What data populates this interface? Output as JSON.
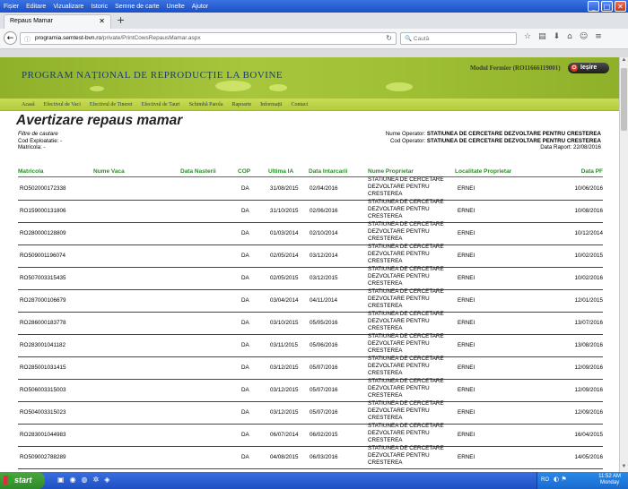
{
  "browser": {
    "menu": [
      "Fișier",
      "Editare",
      "Vizualizare",
      "Istoric",
      "Semne de carte",
      "Unelte",
      "Ajutor"
    ],
    "tab_title": "Repaus Mamar",
    "url_domain": "programia.semtest-bvn.ro",
    "url_prefix": "",
    "url_path": "/private/PrintCowsRepausMamar.aspx",
    "search_placeholder": "Caută"
  },
  "header": {
    "title": "PROGRAM NAȚIONAL DE REPRODUCȚIE LA BOVINE",
    "user_label": "Modul Fermier (RO11666119001)",
    "exit_label": "Ieșire"
  },
  "nav": [
    "Acasă",
    "Efectivul de Vaci",
    "Efectivul de Tineret",
    "Efectivul de Tauri",
    "Schimbă Parola",
    "Rapoarte",
    "Informații",
    "Contact"
  ],
  "report": {
    "title": "Avertizare repaus mamar",
    "filters_label": "Filtre de cautare",
    "cod_exploatatie": "Cod Exploatatie: -",
    "matricola_filter": "Matricola: -",
    "operator_name_label": "Nume Operator:",
    "operator_name": "STATIUNEA DE CERCETARE DEZVOLTARE PENTRU CRESTEREA",
    "operator_code_label": "Cod Operator:",
    "operator_code": "STATIUNEA DE CERCETARE DEZVOLTARE PENTRU CRESTEREA",
    "report_date": "Data Raport: 22/08/2016"
  },
  "columns": [
    "Matricola",
    "Nume Vaca",
    "Data Nasterii",
    "COP",
    "Ultima IA",
    "Data Intarcarii",
    "Nume Proprietar",
    "Localitate Proprietar",
    "Data PF"
  ],
  "rows": [
    {
      "matricola": "RO502000172338",
      "cop": "DA",
      "ultima_ia": "31/08/2015",
      "intarcare": "02/04/2016",
      "proprietar": "STATIUNEA DE CERCETARE DEZVOLTARE PENTRU CRESTEREA",
      "localitate": "ERNEI",
      "pf": "10/06/2016"
    },
    {
      "matricola": "RO159000131806",
      "cop": "DA",
      "ultima_ia": "31/10/2015",
      "intarcare": "02/06/2016",
      "proprietar": "STATIUNEA DE CERCETARE DEZVOLTARE PENTRU CRESTEREA",
      "localitate": "ERNEI",
      "pf": "10/08/2016"
    },
    {
      "matricola": "RO280000128809",
      "cop": "DA",
      "ultima_ia": "01/03/2014",
      "intarcare": "02/10/2014",
      "proprietar": "STATIUNEA DE CERCETARE DEZVOLTARE PENTRU CRESTEREA",
      "localitate": "ERNEI",
      "pf": "10/12/2014"
    },
    {
      "matricola": "RO509001196074",
      "cop": "DA",
      "ultima_ia": "02/05/2014",
      "intarcare": "03/12/2014",
      "proprietar": "STATIUNEA DE CERCETARE DEZVOLTARE PENTRU CRESTEREA",
      "localitate": "ERNEI",
      "pf": "10/02/2015"
    },
    {
      "matricola": "RO507003315435",
      "cop": "DA",
      "ultima_ia": "02/05/2015",
      "intarcare": "03/12/2015",
      "proprietar": "STATIUNEA DE CERCETARE DEZVOLTARE PENTRU CRESTEREA",
      "localitate": "ERNEI",
      "pf": "10/02/2016"
    },
    {
      "matricola": "RO287000106679",
      "cop": "DA",
      "ultima_ia": "03/04/2014",
      "intarcare": "04/11/2014",
      "proprietar": "STATIUNEA DE CERCETARE DEZVOLTARE PENTRU CRESTEREA",
      "localitate": "ERNEI",
      "pf": "12/01/2015"
    },
    {
      "matricola": "RO286000183778",
      "cop": "DA",
      "ultima_ia": "03/10/2015",
      "intarcare": "05/05/2016",
      "proprietar": "STATIUNEA DE CERCETARE DEZVOLTARE PENTRU CRESTEREA",
      "localitate": "ERNEI",
      "pf": "13/07/2016"
    },
    {
      "matricola": "RO283001041182",
      "cop": "DA",
      "ultima_ia": "03/11/2015",
      "intarcare": "05/06/2016",
      "proprietar": "STATIUNEA DE CERCETARE DEZVOLTARE PENTRU CRESTEREA",
      "localitate": "ERNEI",
      "pf": "13/08/2016"
    },
    {
      "matricola": "RO285001031415",
      "cop": "DA",
      "ultima_ia": "03/12/2015",
      "intarcare": "05/07/2016",
      "proprietar": "STATIUNEA DE CERCETARE DEZVOLTARE PENTRU CRESTEREA",
      "localitate": "ERNEI",
      "pf": "12/09/2016"
    },
    {
      "matricola": "RO506003315003",
      "cop": "DA",
      "ultima_ia": "03/12/2015",
      "intarcare": "05/07/2016",
      "proprietar": "STATIUNEA DE CERCETARE DEZVOLTARE PENTRU CRESTEREA",
      "localitate": "ERNEI",
      "pf": "12/09/2016"
    },
    {
      "matricola": "RO504003315023",
      "cop": "DA",
      "ultima_ia": "03/12/2015",
      "intarcare": "05/07/2016",
      "proprietar": "STATIUNEA DE CERCETARE DEZVOLTARE PENTRU CRESTEREA",
      "localitate": "ERNEI",
      "pf": "12/09/2016"
    },
    {
      "matricola": "RO283001044983",
      "cop": "DA",
      "ultima_ia": "06/07/2014",
      "intarcare": "06/02/2015",
      "proprietar": "STATIUNEA DE CERCETARE DEZVOLTARE PENTRU CRESTEREA",
      "localitate": "ERNEI",
      "pf": "16/04/2015"
    },
    {
      "matricola": "RO509002788289",
      "cop": "DA",
      "ultima_ia": "04/08/2015",
      "intarcare": "06/03/2016",
      "proprietar": "STATIUNEA DE CERCETARE DEZVOLTARE PENTRU CRESTEREA",
      "localitate": "ERNEI",
      "pf": "14/05/2016"
    }
  ],
  "taskbar": {
    "start_label": "start",
    "lang": "RO",
    "time": "11:52 AM",
    "day": "Monday"
  },
  "icons": {
    "back": "back-arrow-icon",
    "reload": "reload-icon",
    "search": "search-icon",
    "star": "star-icon",
    "home": "home-icon",
    "menu": "hamburger-menu-icon"
  }
}
